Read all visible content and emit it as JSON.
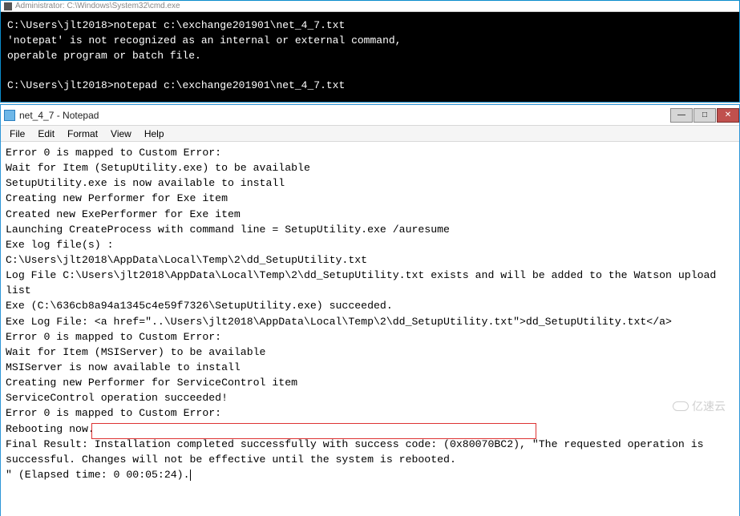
{
  "cmd": {
    "title": "Administrator: C:\\Windows\\System32\\cmd.exe",
    "line1_prompt": "C:\\Users\\jlt2018>",
    "line1_cmd": "notepat c:\\exchange201901\\net_4_7.txt",
    "err1": "'notepat' is not recognized as an internal or external command,",
    "err2": "operable program or batch file.",
    "line2_prompt": "C:\\Users\\jlt2018>",
    "line2_cmd": "notepad c:\\exchange201901\\net_4_7.txt"
  },
  "notepad": {
    "title": "net_4_7 - Notepad",
    "menu": {
      "file": "File",
      "edit": "Edit",
      "format": "Format",
      "view": "View",
      "help": "Help"
    },
    "lines": {
      "l1": "Error 0 is mapped to Custom Error:",
      "l2": "Wait for Item (SetupUtility.exe) to be available",
      "l3": "SetupUtility.exe is now available to install",
      "l4": "Creating new Performer for Exe item",
      "l5": "Created new ExePerformer for Exe item",
      "l6": "Launching CreateProcess with command line = SetupUtility.exe /auresume",
      "l7": "Exe log file(s) :",
      "l8": "C:\\Users\\jlt2018\\AppData\\Local\\Temp\\2\\dd_SetupUtility.txt",
      "l9": "Log File C:\\Users\\jlt2018\\AppData\\Local\\Temp\\2\\dd_SetupUtility.txt exists and will be added to the Watson upload list",
      "l10": "Exe (C:\\636cb8a94a1345c4e59f7326\\SetupUtility.exe) succeeded.",
      "l11": "Exe Log File: <a href=\"..\\Users\\jlt2018\\AppData\\Local\\Temp\\2\\dd_SetupUtility.txt\">dd_SetupUtility.txt</a>",
      "l12": "Error 0 is mapped to Custom Error:",
      "l13": "Wait for Item (MSIServer) to be available",
      "l14": "MSIServer is now available to install",
      "l15": "Creating new Performer for ServiceControl item",
      "l16": "ServiceControl operation succeeded!",
      "l17": "Error 0 is mapped to Custom Error:",
      "l18": "Rebooting now.",
      "l19a": "Final Result: ",
      "l19b": "Installation completed successfully with success code: (0x80070BC2), ",
      "l19c": "\"The requested operation is successful. Changes will not be effective until the system is rebooted.",
      "l20": "\" (Elapsed time: 0 00:05:24)."
    }
  },
  "watermark": "亿速云"
}
